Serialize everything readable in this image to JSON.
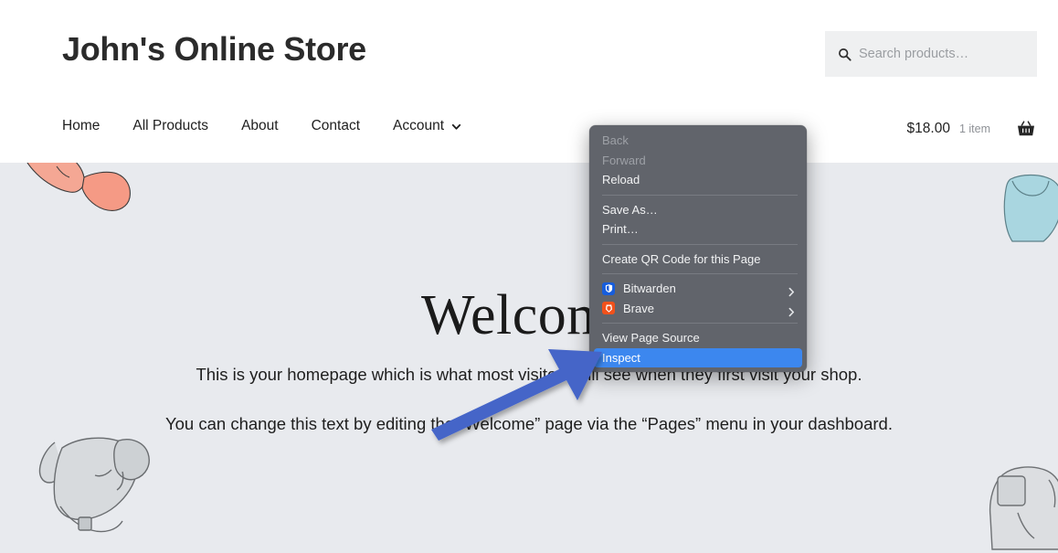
{
  "site": {
    "title": "John's Online Store"
  },
  "search": {
    "icon": "search-icon",
    "placeholder": "Search products…",
    "value": ""
  },
  "nav": {
    "items": [
      {
        "label": "Home"
      },
      {
        "label": "All Products"
      },
      {
        "label": "About"
      },
      {
        "label": "Contact"
      },
      {
        "label": "Account",
        "has_chevron": true,
        "chevron_icon": "chevron-down-icon"
      }
    ]
  },
  "cart": {
    "total": "$18.00",
    "count": "1 item",
    "icon": "shopping-basket-icon"
  },
  "hero": {
    "title": "Welcome",
    "paragraph1": "This is your homepage which is what most visitors will see when they first visit your shop.",
    "paragraph2": "You can change this text by editing the “Welcome” page via the “Pages” menu in your dashboard."
  },
  "context_menu": {
    "items": [
      {
        "label": "Back",
        "state": "disabled",
        "type": "item"
      },
      {
        "label": "Forward",
        "state": "disabled",
        "type": "item"
      },
      {
        "label": "Reload",
        "state": "enabled",
        "type": "item"
      },
      {
        "type": "separator"
      },
      {
        "label": "Save As…",
        "state": "enabled",
        "type": "item"
      },
      {
        "label": "Print…",
        "state": "enabled",
        "type": "item"
      },
      {
        "type": "separator"
      },
      {
        "label": "Create QR Code for this Page",
        "state": "enabled",
        "type": "item"
      },
      {
        "type": "separator"
      },
      {
        "label": "Bitwarden",
        "state": "enabled",
        "type": "submenu",
        "icon": "bitwarden-icon",
        "icon_color": "#175ddc",
        "arrow_icon": "chevron-right-icon"
      },
      {
        "label": "Brave",
        "state": "enabled",
        "type": "submenu",
        "icon": "brave-icon",
        "icon_color": "#f1511b",
        "arrow_icon": "chevron-right-icon"
      },
      {
        "type": "separator"
      },
      {
        "label": "View Page Source",
        "state": "enabled",
        "type": "item"
      },
      {
        "label": "Inspect",
        "state": "selected",
        "type": "item"
      }
    ],
    "background_color": "#61646b",
    "selected_color": "#3c87ef"
  },
  "annotation": {
    "arrow_color": "#4565c8",
    "points_to": "Inspect"
  },
  "decorations": [
    {
      "name": "product-illustration-sweater-pink",
      "color": "#f0a08f"
    },
    {
      "name": "product-illustration-hoodie-gray",
      "color": "#cfd2d6"
    },
    {
      "name": "product-illustration-shirt-blue",
      "color": "#a8d4dd"
    },
    {
      "name": "product-illustration-tshirt-gray",
      "color": "#d8dadd"
    }
  ]
}
